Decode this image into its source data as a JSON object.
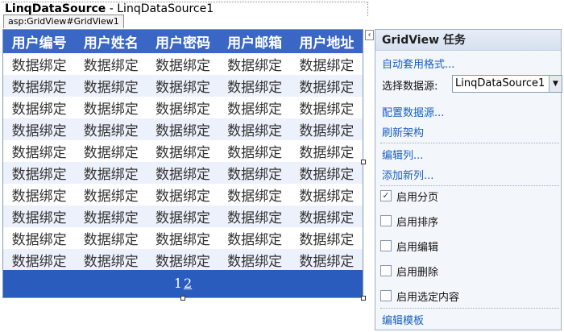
{
  "datasource": {
    "name": "LinqDataSource",
    "separator": " - ",
    "id": "LinqDataSource1"
  },
  "control_tag": "asp:GridView#GridView1",
  "grid": {
    "headers": [
      "用户编号",
      "用户姓名",
      "用户密码",
      "用户邮箱",
      "用户地址"
    ],
    "rows": [
      [
        "数据绑定",
        "数据绑定",
        "数据绑定",
        "数据绑定",
        "数据绑定"
      ],
      [
        "数据绑定",
        "数据绑定",
        "数据绑定",
        "数据绑定",
        "数据绑定"
      ],
      [
        "数据绑定",
        "数据绑定",
        "数据绑定",
        "数据绑定",
        "数据绑定"
      ],
      [
        "数据绑定",
        "数据绑定",
        "数据绑定",
        "数据绑定",
        "数据绑定"
      ],
      [
        "数据绑定",
        "数据绑定",
        "数据绑定",
        "数据绑定",
        "数据绑定"
      ],
      [
        "数据绑定",
        "数据绑定",
        "数据绑定",
        "数据绑定",
        "数据绑定"
      ],
      [
        "数据绑定",
        "数据绑定",
        "数据绑定",
        "数据绑定",
        "数据绑定"
      ],
      [
        "数据绑定",
        "数据绑定",
        "数据绑定",
        "数据绑定",
        "数据绑定"
      ],
      [
        "数据绑定",
        "数据绑定",
        "数据绑定",
        "数据绑定",
        "数据绑定"
      ],
      [
        "数据绑定",
        "数据绑定",
        "数据绑定",
        "数据绑定",
        "数据绑定"
      ]
    ],
    "pager": [
      "1",
      "2"
    ],
    "header_color": "#3a67c5",
    "pager_color": "#2a5cbe"
  },
  "smart_tag_glyph": "‹",
  "tasks": {
    "title": "GridView 任务",
    "auto_format": "自动套用格式...",
    "choose_source_label": "选择数据源:",
    "choose_source_value": "LinqDataSource1",
    "configure_source": "配置数据源...",
    "refresh_schema": "刷新架构",
    "edit_columns": "编辑列...",
    "add_column": "添加新列...",
    "options": [
      {
        "label": "启用分页",
        "checked": true
      },
      {
        "label": "启用排序",
        "checked": false
      },
      {
        "label": "启用编辑",
        "checked": false
      },
      {
        "label": "启用删除",
        "checked": false
      },
      {
        "label": "启用选定内容",
        "checked": false
      }
    ],
    "edit_templates": "编辑模板",
    "link_color": "#1760c2"
  }
}
